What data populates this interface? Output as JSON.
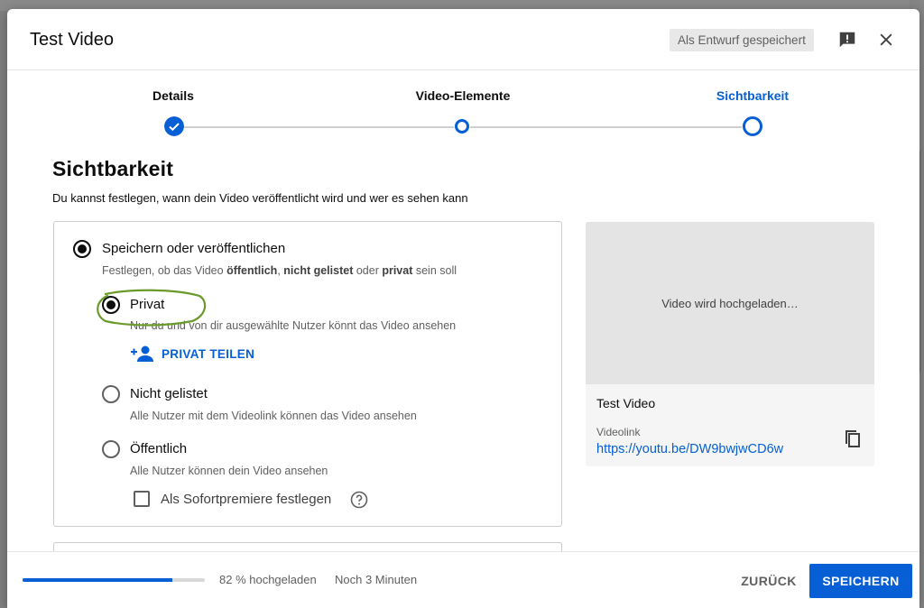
{
  "dialog": {
    "title": "Test Video",
    "draft_badge": "Als Entwurf gespeichert",
    "feedback_icon": "feedback-icon",
    "close_icon": "close-icon"
  },
  "stepper": {
    "steps": [
      {
        "label": "Details",
        "state": "done"
      },
      {
        "label": "Video-Elemente",
        "state": "visited"
      },
      {
        "label": "Sichtbarkeit",
        "state": "active"
      }
    ],
    "accent": "#065fd4"
  },
  "visibility": {
    "title": "Sichtbarkeit",
    "subtitle": "Du kannst festlegen, wann dein Video veröffentlicht wird und wer es sehen kann",
    "save_publish": {
      "label": "Speichern oder veröffentlichen",
      "desc_parts": [
        "Festlegen, ob das Video ",
        "öffentlich",
        ", ",
        "nicht gelistet",
        " oder ",
        "privat",
        " sein soll"
      ],
      "selected": true
    },
    "options": [
      {
        "label": "Privat",
        "desc": "Nur du und von dir ausgewählte Nutzer könnt das Video ansehen",
        "selected": true
      },
      {
        "label": "Nicht gelistet",
        "desc": "Alle Nutzer mit dem Videolink können das Video ansehen",
        "selected": false
      },
      {
        "label": "Öffentlich",
        "desc": "Alle Nutzer können dein Video ansehen",
        "selected": false
      }
    ],
    "share_private": "PRIVAT TEILEN",
    "premiere_checkbox": {
      "label": "Als Sofortpremiere festlegen",
      "checked": false
    }
  },
  "preview": {
    "status": "Video wird hochgeladen…",
    "title": "Test Video",
    "link_label": "Videolink",
    "link": "https://youtu.be/DW9bwjwCD6w"
  },
  "footer": {
    "upload_progress": 0.82,
    "upload_status": "82 % hochgeladen",
    "time_left": "Noch 3 Minuten",
    "back_label": "ZURÜCK",
    "save_label": "SPEICHERN"
  }
}
